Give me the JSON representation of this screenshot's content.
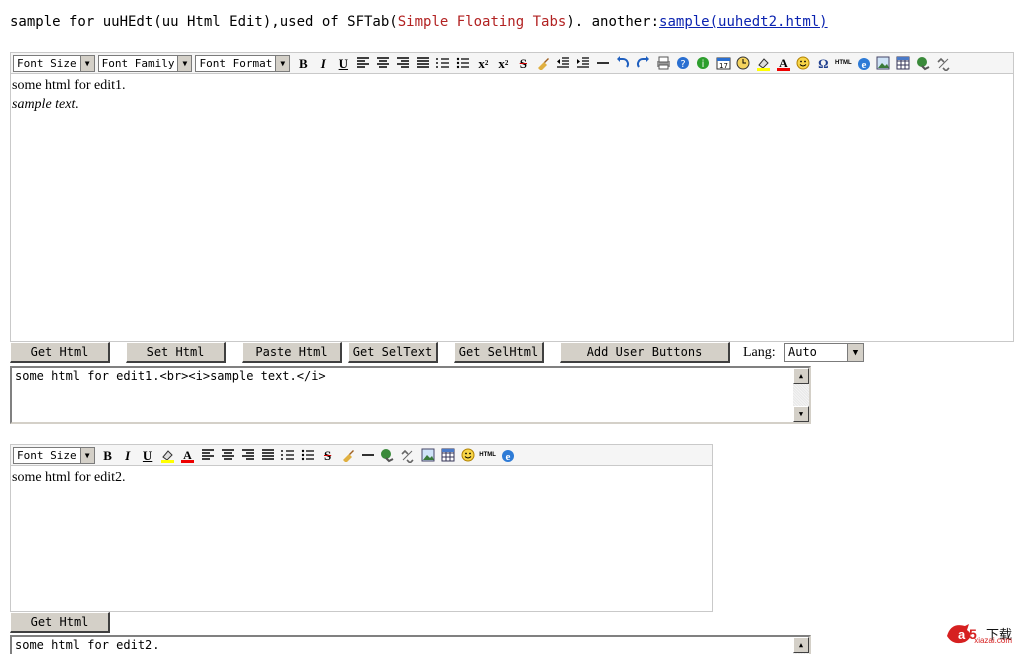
{
  "intro": {
    "text_before": "sample for uuHEdt(uu Html Edit),used of SFTab(",
    "accent_text": "Simple Floating Tabs",
    "text_middle": "). another:",
    "link_text": "sample(uuhedt2.html)",
    "accent_color": "#b22222",
    "link_color": "#0b23b0"
  },
  "editor1": {
    "toolbar": {
      "font_size": "Font Size",
      "font_family": "Font Family",
      "font_format": "Font Format",
      "icons": [
        "bold-icon",
        "italic-icon",
        "underline-icon",
        "align-left-icon",
        "align-center-icon",
        "align-right-icon",
        "align-justify-icon",
        "ordered-list-icon",
        "unordered-list-icon",
        "subscript-icon",
        "superscript-icon",
        "strikethrough-icon",
        "clean-format-icon",
        "outdent-icon",
        "indent-icon",
        "horizontal-rule-icon",
        "undo-icon",
        "redo-icon",
        "print-icon",
        "help-icon",
        "about-icon",
        "date-icon",
        "time-icon",
        "background-color-icon",
        "font-color-icon",
        "smiley-icon",
        "special-char-icon",
        "html-mode-icon",
        "preview-icon",
        "image-icon",
        "table-icon",
        "link-icon",
        "unlink-icon"
      ]
    },
    "line1": "some html for edit1.",
    "line2": "sample text."
  },
  "buttons": {
    "get_html": "Get Html",
    "set_html": "Set Html",
    "paste_html": "Paste Html",
    "get_seltext": "Get SelText",
    "get_selhtml": "Get SelHtml",
    "add_user_buttons": "Add User Buttons"
  },
  "lang": {
    "label": "Lang:",
    "value": "Auto"
  },
  "output1": "some html for edit1.<br><i>sample text.</i>",
  "editor2": {
    "toolbar": {
      "font_size": "Font Size",
      "icons": [
        "bold-icon",
        "italic-icon",
        "underline-icon",
        "background-color-icon",
        "font-color-icon",
        "align-left-icon",
        "align-center-icon",
        "align-right-icon",
        "align-justify-icon",
        "ordered-list-icon",
        "unordered-list-icon",
        "strikethrough-icon",
        "clean-format-icon",
        "horizontal-rule-icon",
        "link-icon",
        "unlink-icon",
        "image-icon",
        "table-icon",
        "smiley-icon",
        "html-mode-icon",
        "preview-icon"
      ]
    },
    "line1": "some html for edit2."
  },
  "buttons2": {
    "get_html": "Get Html"
  },
  "output2": "some html for edit2.",
  "watermark": {
    "chinese": "下载",
    "domain": "xiazai.com",
    "color": "#d62020"
  }
}
